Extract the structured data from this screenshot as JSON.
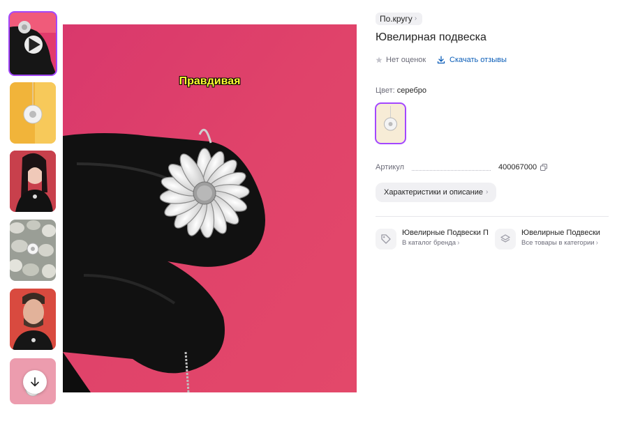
{
  "gallery": {
    "thumbnails": [
      {
        "kind": "video",
        "alt": "black glove holding flower pendant on pink"
      },
      {
        "kind": "photo",
        "alt": "pendant on yellow background"
      },
      {
        "kind": "photo",
        "alt": "woman wearing pendant"
      },
      {
        "kind": "photo",
        "alt": "pendant on white stones"
      },
      {
        "kind": "photo",
        "alt": "man wearing pendant"
      },
      {
        "kind": "photo",
        "alt": "pendant on pink"
      }
    ],
    "video_caption": "Правдивая",
    "icons": {
      "play": "play-icon",
      "scroll": "arrow-down-icon"
    }
  },
  "product": {
    "brand": "По.кругу",
    "title": "Ювелирная подвеска",
    "rating_text": "Нет оценок",
    "download_reviews": "Скачать отзывы",
    "color_label": "Цвет:",
    "color_value": "серебро",
    "article_label": "Артикул",
    "article_value": "400067000",
    "chars_button": "Характеристики и описание",
    "categories": [
      {
        "title": "Ювелирные Подвески П",
        "subtitle": "В каталог бренда",
        "icon": "tag-icon"
      },
      {
        "title": "Ювелирные Подвески",
        "subtitle": "Все товары в категории",
        "icon": "layers-icon"
      }
    ]
  },
  "colors": {
    "accent": "#a347ff",
    "link": "#0a5db8",
    "caption": "#ffff33",
    "background_pink": "#e0386a"
  }
}
